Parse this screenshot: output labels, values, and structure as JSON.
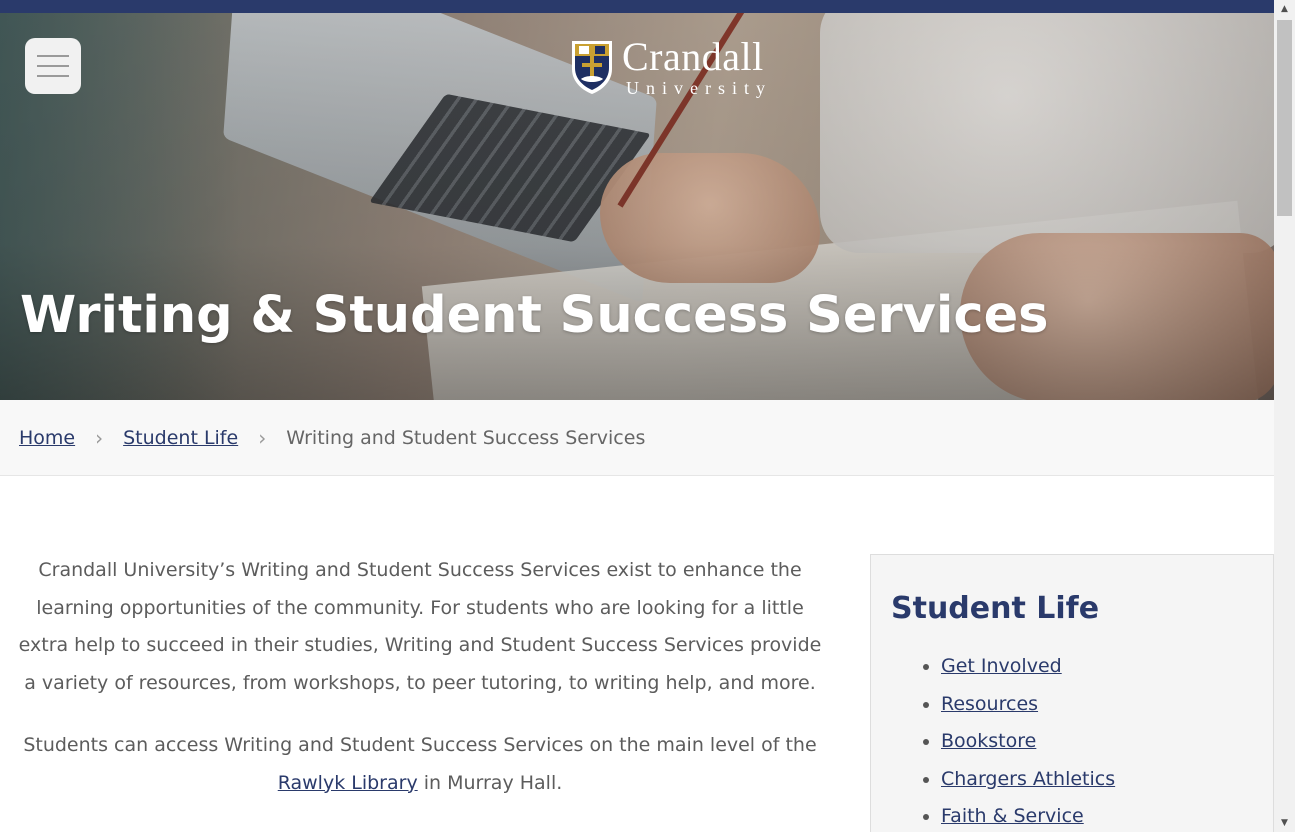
{
  "header": {
    "logo_name": "Crandall",
    "logo_sub": "University",
    "hero_title": "Writing & Student Success Services"
  },
  "breadcrumb": {
    "items": [
      "Home",
      "Student Life"
    ],
    "current": "Writing and Student Success Services",
    "separator": "›"
  },
  "main": {
    "paragraph1": "Crandall University’s Writing and Student Success Services exist to enhance the learning opportunities of the community. For students who are looking for a little extra help to succeed in their studies, Writing and Student Success Services provide a variety of resources, from workshops, to peer tutoring, to writing help, and more.",
    "paragraph2_before": "Students can access Writing and Student Success Services on the main level of the ",
    "paragraph2_link": "Rawlyk Library",
    "paragraph2_after": " in Murray Hall."
  },
  "sidebar": {
    "title": "Student Life",
    "links": [
      "Get Involved",
      "Resources",
      "Bookstore",
      "Chargers Athletics",
      "Faith & Service"
    ]
  },
  "colors": {
    "brand_navy": "#2a3a6b",
    "crumb_bg": "#f8f8f8",
    "sidebar_bg": "#f5f5f5"
  },
  "icons": {
    "menu": "hamburger-icon",
    "logo": "shield-icon",
    "scroll_up": "triangle-up-icon",
    "scroll_down": "triangle-down-icon"
  }
}
